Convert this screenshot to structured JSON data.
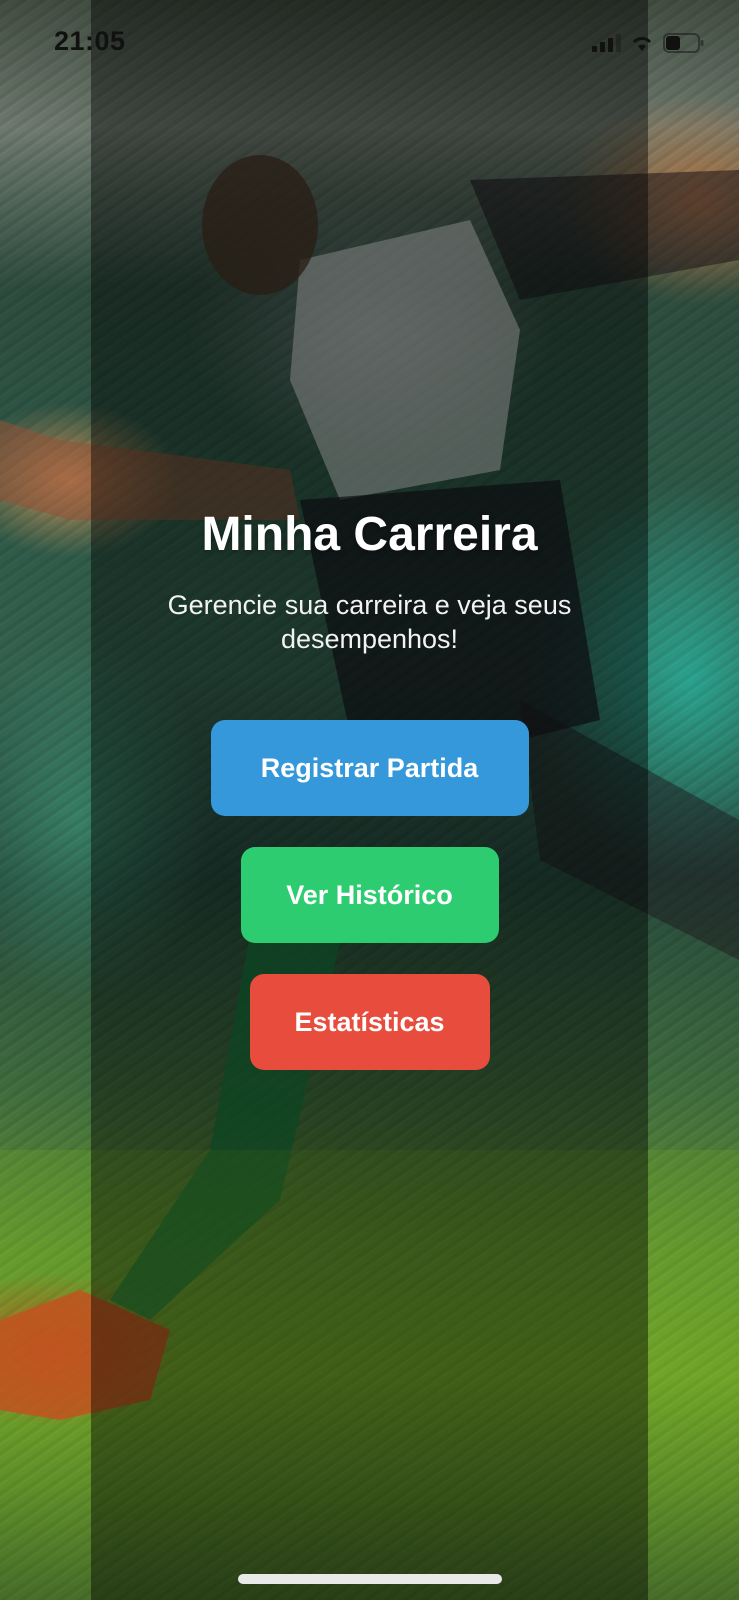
{
  "status_bar": {
    "time": "21:05",
    "icons": [
      "signal-icon",
      "wifi-icon",
      "battery-icon"
    ]
  },
  "background": {
    "description_icon": "soccer-player-image"
  },
  "main": {
    "title": "Minha Carreira",
    "subtitle": "Gerencie sua carreira e veja seus desempenhos!",
    "buttons": [
      {
        "label": "Registrar Partida",
        "color": "#3498db"
      },
      {
        "label": "Ver Histórico",
        "color": "#2ecc71"
      },
      {
        "label": "Estatísticas",
        "color": "#e74c3c"
      }
    ]
  },
  "colors": {
    "overlay": "#000000",
    "text": "#ffffff"
  }
}
